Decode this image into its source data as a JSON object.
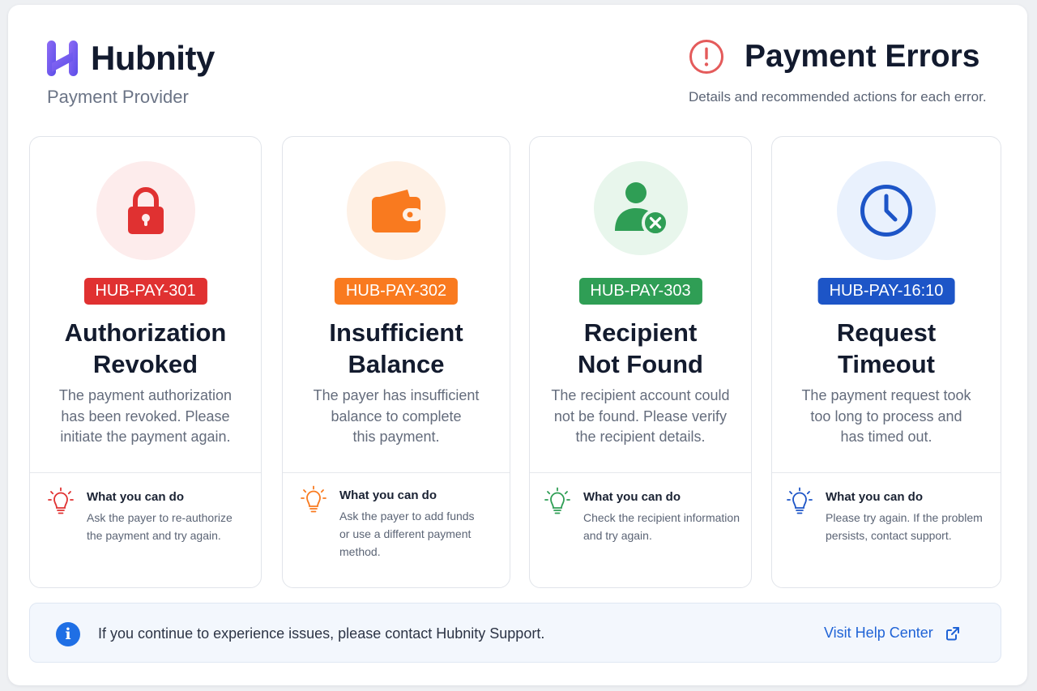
{
  "brand": {
    "name": "Hubnity",
    "subtitle": "Payment Provider",
    "accent": "#7b5cf0"
  },
  "header": {
    "title": "Payment Errors",
    "subtitle": "Details and recommended actions for each error.",
    "alert_color": "#e45b5b"
  },
  "errors": [
    {
      "code": "HUB-PAY-301",
      "title_line1": "Authorization",
      "title_line2": "Revoked",
      "desc_line1": "The payment authorization",
      "desc_line2": "has been revoked. Please",
      "desc_line3": "initiate the payment again.",
      "tip_title": "What you can do",
      "tip_line1": "Ask the payer to re-authorize",
      "tip_line2": "the payment and try again.",
      "tip_line3": "",
      "icon": "lock-icon",
      "color": "#e03131",
      "tint": "#fdecec"
    },
    {
      "code": "HUB-PAY-302",
      "title_line1": "Insufficient",
      "title_line2": "Balance",
      "desc_line1": "The payer has insufficient",
      "desc_line2": "balance to complete",
      "desc_line3": "this payment.",
      "tip_title": "What you can do",
      "tip_line1": "Ask the payer to add funds",
      "tip_line2": "or use a different payment",
      "tip_line3": "method.",
      "icon": "wallet-icon",
      "color": "#f97a1f",
      "tint": "#fef1e6"
    },
    {
      "code": "HUB-PAY-303",
      "title_line1": "Recipient",
      "title_line2": "Not Found",
      "desc_line1": "The recipient account could",
      "desc_line2": "not be found. Please verify",
      "desc_line3": "the recipient details.",
      "tip_title": "What you can do",
      "tip_line1": "Check the recipient information",
      "tip_line2": "and try again.",
      "tip_line3": "",
      "icon": "user-remove-icon",
      "color": "#2f9e55",
      "tint": "#e8f6ec"
    },
    {
      "code": "HUB-PAY-16:10",
      "title_line1": "Request",
      "title_line2": "Timeout",
      "desc_line1": "The payment request took",
      "desc_line2": "too long to process and",
      "desc_line3": "has timed out.",
      "tip_title": "What you can do",
      "tip_line1": "Please try again. If the problem",
      "tip_line2": "persists, contact support.",
      "tip_line3": "",
      "icon": "clock-icon",
      "color": "#1d55c7",
      "tint": "#e9f1fd"
    }
  ],
  "footer": {
    "message": "If you continue to experience issues, please contact Hubnity Support.",
    "link_label": "Visit Help Center",
    "info_glyph": "i"
  }
}
